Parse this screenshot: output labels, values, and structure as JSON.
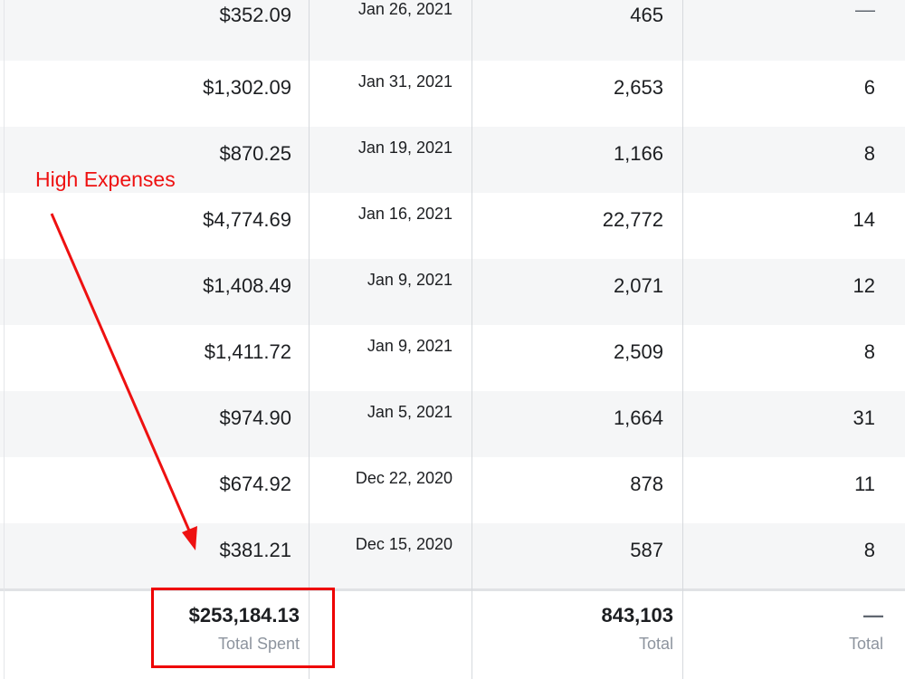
{
  "annotation": {
    "label": "High Expenses",
    "color": "#ee1111"
  },
  "rows": [
    {
      "spent": "$352.09",
      "date": "Jan 26, 2021",
      "reach": "465",
      "results": "—"
    },
    {
      "spent": "$1,302.09",
      "date": "Jan 31, 2021",
      "reach": "2,653",
      "results": "6"
    },
    {
      "spent": "$870.25",
      "date": "Jan 19, 2021",
      "reach": "1,166",
      "results": "8"
    },
    {
      "spent": "$4,774.69",
      "date": "Jan 16, 2021",
      "reach": "22,772",
      "results": "14"
    },
    {
      "spent": "$1,408.49",
      "date": "Jan 9, 2021",
      "reach": "2,071",
      "results": "12"
    },
    {
      "spent": "$1,411.72",
      "date": "Jan 9, 2021",
      "reach": "2,509",
      "results": "8"
    },
    {
      "spent": "$974.90",
      "date": "Jan 5, 2021",
      "reach": "1,664",
      "results": "31"
    },
    {
      "spent": "$674.92",
      "date": "Dec 22, 2020",
      "reach": "878",
      "results": "11"
    },
    {
      "spent": "$381.21",
      "date": "Dec 15, 2020",
      "reach": "587",
      "results": "8"
    }
  ],
  "footer": {
    "spent_total": "$253,184.13",
    "spent_label": "Total Spent",
    "reach_total": "843,103",
    "reach_label": "Total",
    "results_total": "—",
    "results_label": "Total"
  }
}
